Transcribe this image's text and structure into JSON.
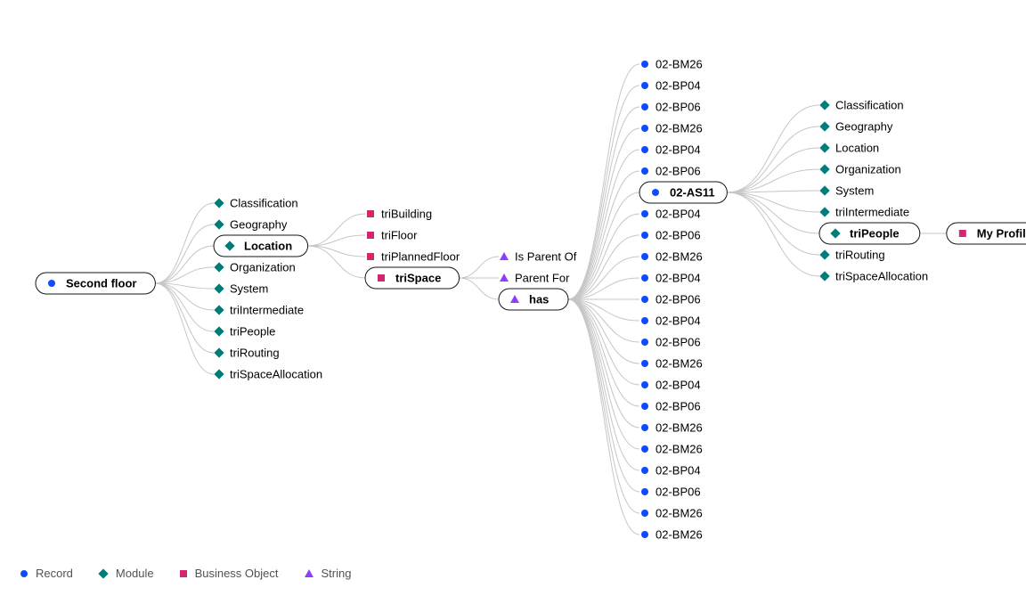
{
  "legend": {
    "record": "Record",
    "module": "Module",
    "business_object": "Business Object",
    "string": "String"
  },
  "colors": {
    "record": "#0f4bff",
    "module": "#007d79",
    "business_object": "#d12771",
    "string": "#8a3ffc",
    "edge": "#c6c6c6",
    "pillStroke": "#161616"
  },
  "nodes": {
    "root": {
      "label": "Second floor",
      "type": "record",
      "pill": true
    },
    "root_children": [
      {
        "label": "Classification",
        "type": "module"
      },
      {
        "label": "Geography",
        "type": "module"
      },
      {
        "label": "Location",
        "type": "module",
        "pill": true,
        "key": "location"
      },
      {
        "label": "Organization",
        "type": "module"
      },
      {
        "label": "System",
        "type": "module"
      },
      {
        "label": "triIntermediate",
        "type": "module"
      },
      {
        "label": "triPeople",
        "type": "module"
      },
      {
        "label": "triRouting",
        "type": "module"
      },
      {
        "label": "triSpaceAllocation",
        "type": "module"
      }
    ],
    "location_children": [
      {
        "label": "triBuilding",
        "type": "business_object"
      },
      {
        "label": "triFloor",
        "type": "business_object"
      },
      {
        "label": "triPlannedFloor",
        "type": "business_object"
      },
      {
        "label": "triSpace",
        "type": "business_object",
        "pill": true,
        "key": "triSpace"
      }
    ],
    "triSpace_children": [
      {
        "label": "Is Parent Of",
        "type": "string"
      },
      {
        "label": "Parent For",
        "type": "string"
      },
      {
        "label": "has",
        "type": "string",
        "pill": true,
        "key": "has"
      }
    ],
    "has_children": [
      {
        "label": "02-BM26",
        "type": "record"
      },
      {
        "label": "02-BP04",
        "type": "record"
      },
      {
        "label": "02-BP06",
        "type": "record"
      },
      {
        "label": "02-BM26",
        "type": "record"
      },
      {
        "label": "02-BP04",
        "type": "record"
      },
      {
        "label": "02-BP06",
        "type": "record"
      },
      {
        "label": "02-AS11",
        "type": "record",
        "pill": true,
        "key": "as11"
      },
      {
        "label": "02-BP04",
        "type": "record"
      },
      {
        "label": "02-BP06",
        "type": "record"
      },
      {
        "label": "02-BM26",
        "type": "record"
      },
      {
        "label": "02-BP04",
        "type": "record"
      },
      {
        "label": "02-BP06",
        "type": "record"
      },
      {
        "label": "02-BP04",
        "type": "record"
      },
      {
        "label": "02-BP06",
        "type": "record"
      },
      {
        "label": "02-BM26",
        "type": "record"
      },
      {
        "label": "02-BP04",
        "type": "record"
      },
      {
        "label": "02-BP06",
        "type": "record"
      },
      {
        "label": "02-BM26",
        "type": "record"
      },
      {
        "label": "02-BM26",
        "type": "record"
      },
      {
        "label": "02-BP04",
        "type": "record"
      },
      {
        "label": "02-BP06",
        "type": "record"
      },
      {
        "label": "02-BM26",
        "type": "record"
      },
      {
        "label": "02-BM26",
        "type": "record"
      }
    ],
    "as11_children": [
      {
        "label": "Classification",
        "type": "module"
      },
      {
        "label": "Geography",
        "type": "module"
      },
      {
        "label": "Location",
        "type": "module"
      },
      {
        "label": "Organization",
        "type": "module"
      },
      {
        "label": "System",
        "type": "module"
      },
      {
        "label": "triIntermediate",
        "type": "module"
      },
      {
        "label": "triPeople",
        "type": "module",
        "pill": true,
        "key": "triPeople"
      },
      {
        "label": "triRouting",
        "type": "module"
      },
      {
        "label": "triSpaceAllocation",
        "type": "module"
      }
    ],
    "triPeople_children": [
      {
        "label": "My Profile",
        "type": "business_object",
        "pill": true
      }
    ]
  }
}
